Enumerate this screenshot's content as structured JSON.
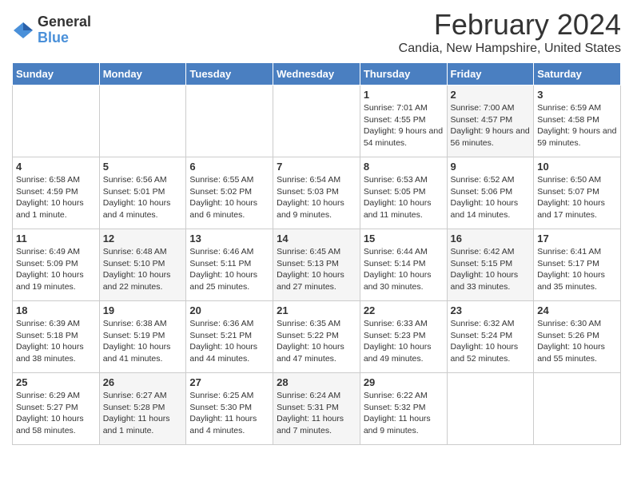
{
  "logo": {
    "general": "General",
    "blue": "Blue"
  },
  "title": {
    "month": "February 2024",
    "location": "Candia, New Hampshire, United States"
  },
  "headers": [
    "Sunday",
    "Monday",
    "Tuesday",
    "Wednesday",
    "Thursday",
    "Friday",
    "Saturday"
  ],
  "weeks": [
    [
      {
        "day": "",
        "info": ""
      },
      {
        "day": "",
        "info": ""
      },
      {
        "day": "",
        "info": ""
      },
      {
        "day": "",
        "info": ""
      },
      {
        "day": "1",
        "sunrise": "Sunrise: 7:01 AM",
        "sunset": "Sunset: 4:55 PM",
        "daylight": "Daylight: 9 hours and 54 minutes."
      },
      {
        "day": "2",
        "sunrise": "Sunrise: 7:00 AM",
        "sunset": "Sunset: 4:57 PM",
        "daylight": "Daylight: 9 hours and 56 minutes."
      },
      {
        "day": "3",
        "sunrise": "Sunrise: 6:59 AM",
        "sunset": "Sunset: 4:58 PM",
        "daylight": "Daylight: 9 hours and 59 minutes."
      }
    ],
    [
      {
        "day": "4",
        "sunrise": "Sunrise: 6:58 AM",
        "sunset": "Sunset: 4:59 PM",
        "daylight": "Daylight: 10 hours and 1 minute."
      },
      {
        "day": "5",
        "sunrise": "Sunrise: 6:56 AM",
        "sunset": "Sunset: 5:01 PM",
        "daylight": "Daylight: 10 hours and 4 minutes."
      },
      {
        "day": "6",
        "sunrise": "Sunrise: 6:55 AM",
        "sunset": "Sunset: 5:02 PM",
        "daylight": "Daylight: 10 hours and 6 minutes."
      },
      {
        "day": "7",
        "sunrise": "Sunrise: 6:54 AM",
        "sunset": "Sunset: 5:03 PM",
        "daylight": "Daylight: 10 hours and 9 minutes."
      },
      {
        "day": "8",
        "sunrise": "Sunrise: 6:53 AM",
        "sunset": "Sunset: 5:05 PM",
        "daylight": "Daylight: 10 hours and 11 minutes."
      },
      {
        "day": "9",
        "sunrise": "Sunrise: 6:52 AM",
        "sunset": "Sunset: 5:06 PM",
        "daylight": "Daylight: 10 hours and 14 minutes."
      },
      {
        "day": "10",
        "sunrise": "Sunrise: 6:50 AM",
        "sunset": "Sunset: 5:07 PM",
        "daylight": "Daylight: 10 hours and 17 minutes."
      }
    ],
    [
      {
        "day": "11",
        "sunrise": "Sunrise: 6:49 AM",
        "sunset": "Sunset: 5:09 PM",
        "daylight": "Daylight: 10 hours and 19 minutes."
      },
      {
        "day": "12",
        "sunrise": "Sunrise: 6:48 AM",
        "sunset": "Sunset: 5:10 PM",
        "daylight": "Daylight: 10 hours and 22 minutes."
      },
      {
        "day": "13",
        "sunrise": "Sunrise: 6:46 AM",
        "sunset": "Sunset: 5:11 PM",
        "daylight": "Daylight: 10 hours and 25 minutes."
      },
      {
        "day": "14",
        "sunrise": "Sunrise: 6:45 AM",
        "sunset": "Sunset: 5:13 PM",
        "daylight": "Daylight: 10 hours and 27 minutes."
      },
      {
        "day": "15",
        "sunrise": "Sunrise: 6:44 AM",
        "sunset": "Sunset: 5:14 PM",
        "daylight": "Daylight: 10 hours and 30 minutes."
      },
      {
        "day": "16",
        "sunrise": "Sunrise: 6:42 AM",
        "sunset": "Sunset: 5:15 PM",
        "daylight": "Daylight: 10 hours and 33 minutes."
      },
      {
        "day": "17",
        "sunrise": "Sunrise: 6:41 AM",
        "sunset": "Sunset: 5:17 PM",
        "daylight": "Daylight: 10 hours and 35 minutes."
      }
    ],
    [
      {
        "day": "18",
        "sunrise": "Sunrise: 6:39 AM",
        "sunset": "Sunset: 5:18 PM",
        "daylight": "Daylight: 10 hours and 38 minutes."
      },
      {
        "day": "19",
        "sunrise": "Sunrise: 6:38 AM",
        "sunset": "Sunset: 5:19 PM",
        "daylight": "Daylight: 10 hours and 41 minutes."
      },
      {
        "day": "20",
        "sunrise": "Sunrise: 6:36 AM",
        "sunset": "Sunset: 5:21 PM",
        "daylight": "Daylight: 10 hours and 44 minutes."
      },
      {
        "day": "21",
        "sunrise": "Sunrise: 6:35 AM",
        "sunset": "Sunset: 5:22 PM",
        "daylight": "Daylight: 10 hours and 47 minutes."
      },
      {
        "day": "22",
        "sunrise": "Sunrise: 6:33 AM",
        "sunset": "Sunset: 5:23 PM",
        "daylight": "Daylight: 10 hours and 49 minutes."
      },
      {
        "day": "23",
        "sunrise": "Sunrise: 6:32 AM",
        "sunset": "Sunset: 5:24 PM",
        "daylight": "Daylight: 10 hours and 52 minutes."
      },
      {
        "day": "24",
        "sunrise": "Sunrise: 6:30 AM",
        "sunset": "Sunset: 5:26 PM",
        "daylight": "Daylight: 10 hours and 55 minutes."
      }
    ],
    [
      {
        "day": "25",
        "sunrise": "Sunrise: 6:29 AM",
        "sunset": "Sunset: 5:27 PM",
        "daylight": "Daylight: 10 hours and 58 minutes."
      },
      {
        "day": "26",
        "sunrise": "Sunrise: 6:27 AM",
        "sunset": "Sunset: 5:28 PM",
        "daylight": "Daylight: 11 hours and 1 minute."
      },
      {
        "day": "27",
        "sunrise": "Sunrise: 6:25 AM",
        "sunset": "Sunset: 5:30 PM",
        "daylight": "Daylight: 11 hours and 4 minutes."
      },
      {
        "day": "28",
        "sunrise": "Sunrise: 6:24 AM",
        "sunset": "Sunset: 5:31 PM",
        "daylight": "Daylight: 11 hours and 7 minutes."
      },
      {
        "day": "29",
        "sunrise": "Sunrise: 6:22 AM",
        "sunset": "Sunset: 5:32 PM",
        "daylight": "Daylight: 11 hours and 9 minutes."
      },
      {
        "day": "",
        "info": ""
      },
      {
        "day": "",
        "info": ""
      }
    ]
  ]
}
